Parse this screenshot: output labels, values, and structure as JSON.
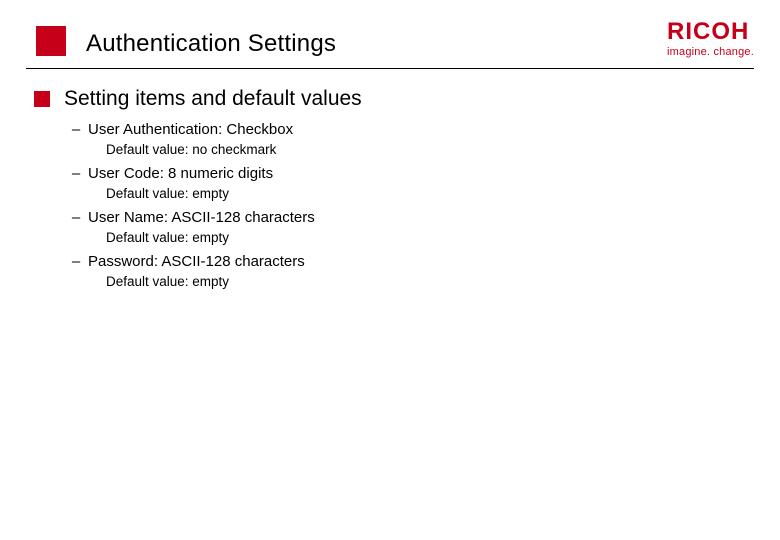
{
  "header": {
    "title": "Authentication Settings"
  },
  "brand": {
    "name": "RICOH",
    "tagline": "imagine. change."
  },
  "section": {
    "title": "Setting items and default values"
  },
  "items": [
    {
      "label": "User Authentication: Checkbox",
      "default": "Default value: no checkmark"
    },
    {
      "label": "User Code: 8 numeric digits",
      "default": "Default value: empty"
    },
    {
      "label": "User Name: ASCII-128 characters",
      "default": "Default value: empty"
    },
    {
      "label": "Password: ASCII-128 characters",
      "default": "Default value: empty"
    }
  ]
}
